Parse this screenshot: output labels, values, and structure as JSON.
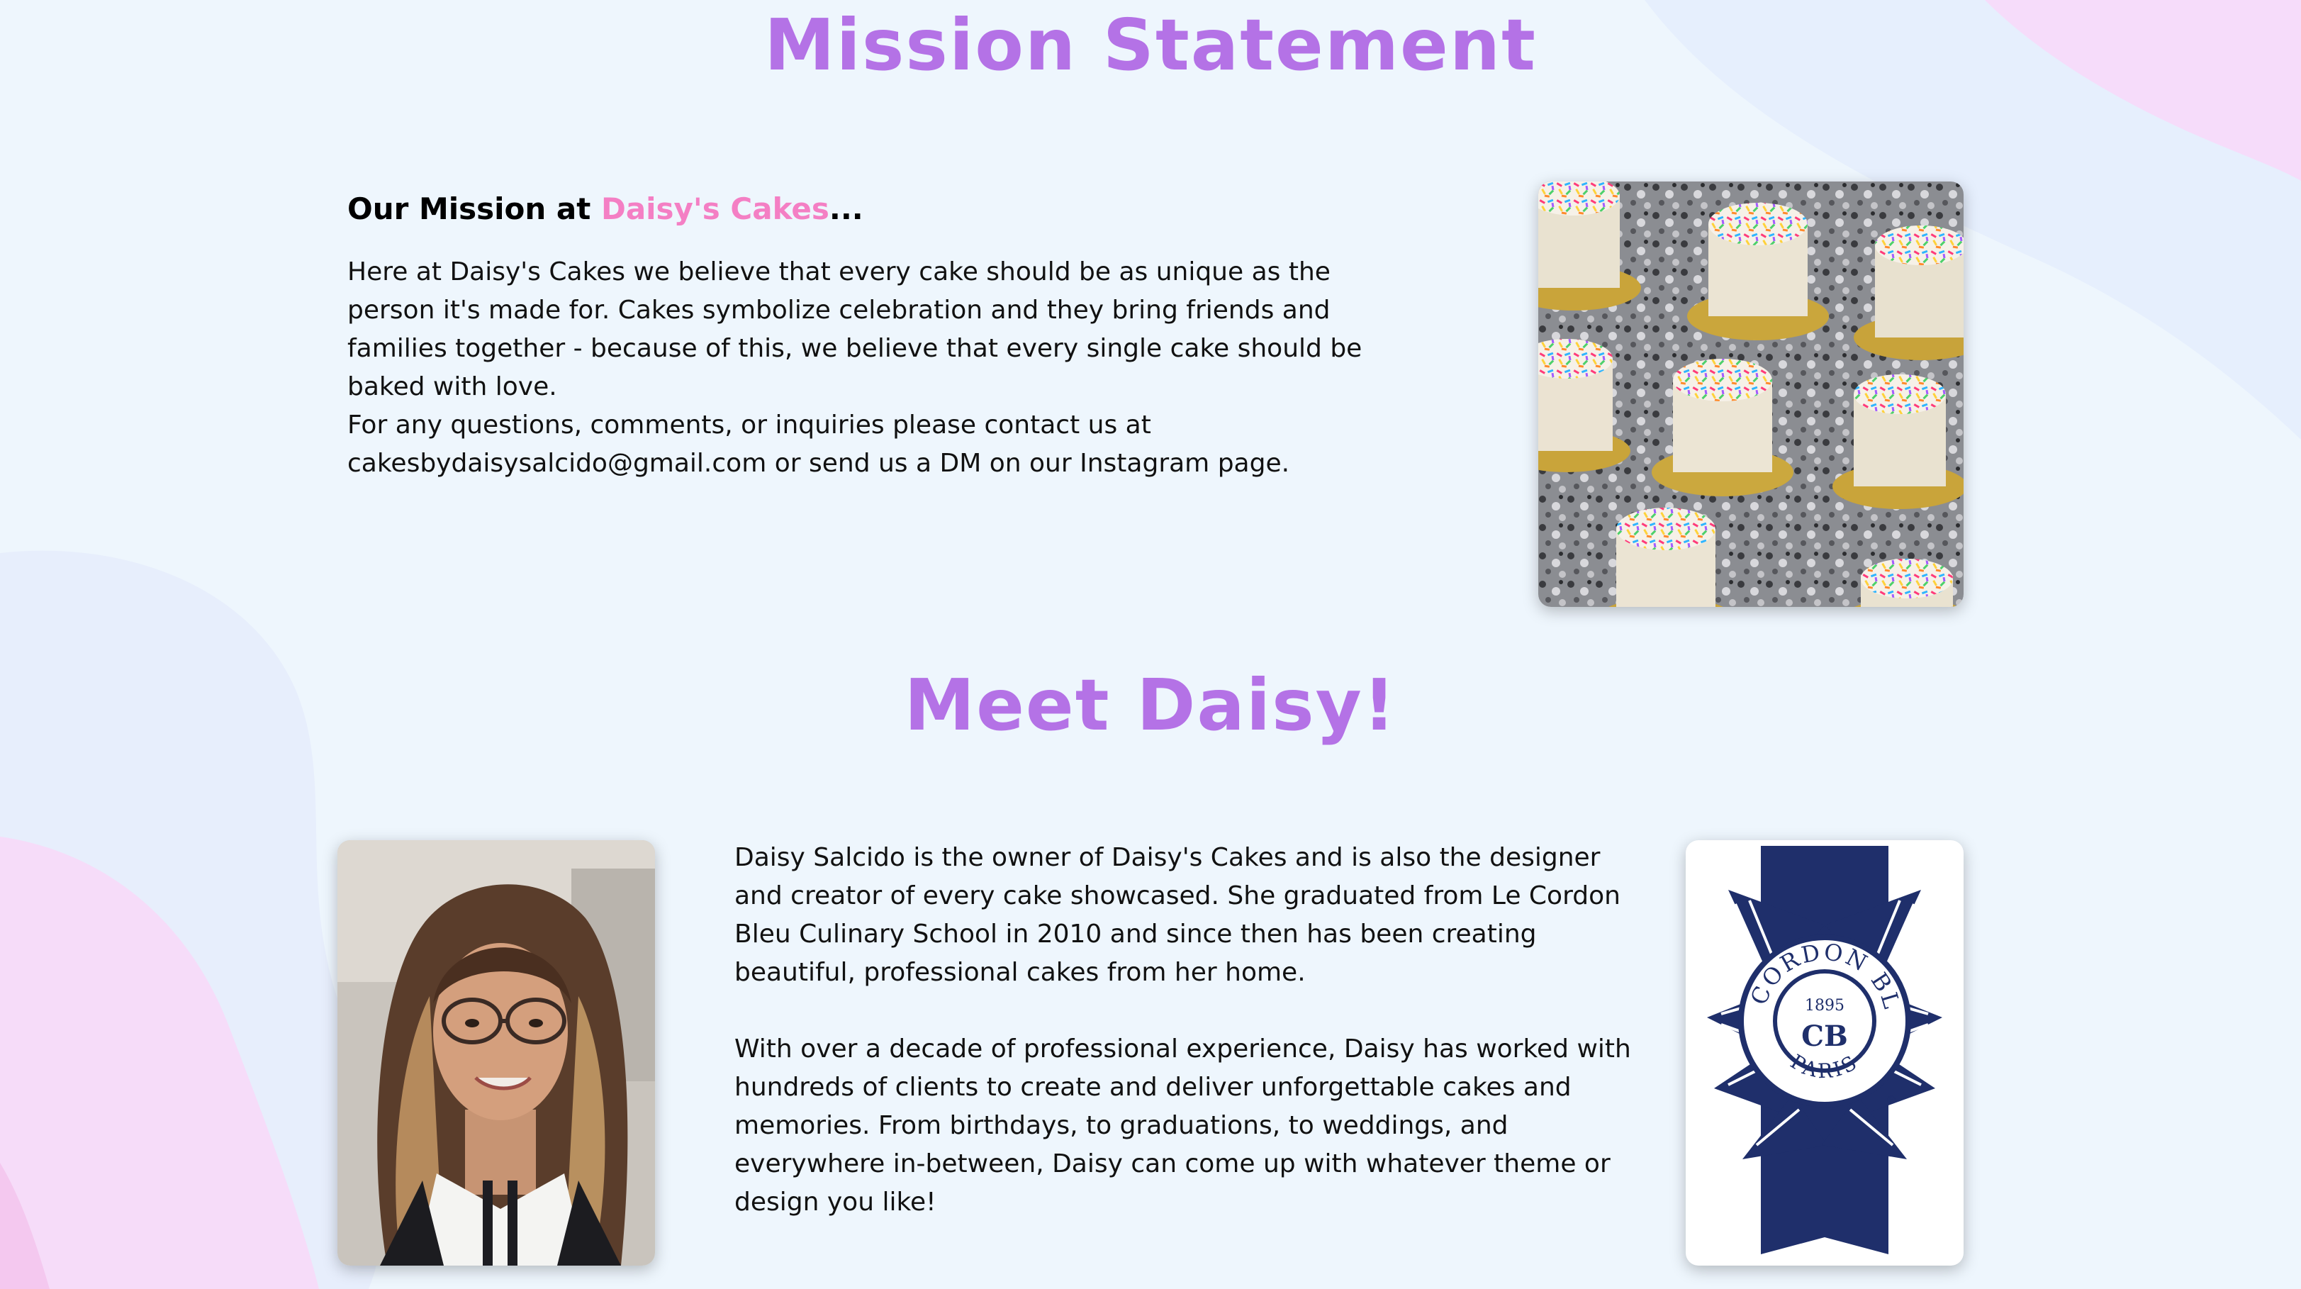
{
  "mission": {
    "title": "Mission Statement",
    "heading_prefix": "Our Mission at ",
    "heading_brand": "Daisy's Cakes",
    "heading_suffix": "...",
    "paragraph1": "Here at Daisy's Cakes we believe that every cake should be as unique as the person it's made for. Cakes symbolize celebration and they bring friends and families together - because of this, we believe that every single cake should be baked with love.",
    "paragraph2": "For any questions, comments, or inquiries please contact us at cakesbydaisysalcido@gmail.com or send us a DM on our Instagram page."
  },
  "meet": {
    "title": "Meet Daisy!",
    "paragraph1": "Daisy Salcido is the owner of Daisy's Cakes and is also the designer and creator of every cake showcased. She graduated from Le Cordon Bleu Culinary School in 2010 and since then has been creating beautiful, professional cakes from her home.",
    "paragraph2": "With over a decade of professional experience, Daisy has worked with hundreds of clients to create and deliver unforgettable cakes and memories. From birthdays, to graduations, to weddings, and everywhere in-between, Daisy can come up with whatever theme or design you like!"
  },
  "logo": {
    "top_text": "LE CORDON BLEU",
    "year": "1895",
    "bottom_text": "PARIS",
    "monogram": "CB",
    "registered": "®"
  },
  "colors": {
    "title": "#b472e6",
    "brand": "#f47fc4",
    "background": "#eef6fd",
    "logo_navy": "#1f2f6b"
  },
  "icons": {
    "cake_photo": "cake-photo-icon",
    "portrait": "portrait-icon",
    "logo": "le-cordon-bleu-logo-icon"
  }
}
